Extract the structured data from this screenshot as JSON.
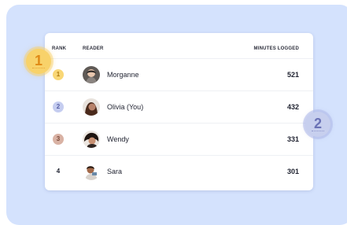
{
  "table": {
    "headers": {
      "rank": "RANK",
      "reader": "READER",
      "minutes": "MINUTES LOGGED"
    },
    "rows": [
      {
        "rank": "1",
        "name": "Morganne",
        "minutes": "521",
        "rank_color": "#f9d776",
        "rank_text_color": "#b07b10"
      },
      {
        "rank": "2",
        "name": "Olivia (You)",
        "minutes": "432",
        "rank_color": "#c5cdf0",
        "rank_text_color": "#5a62a6"
      },
      {
        "rank": "3",
        "name": "Wendy",
        "minutes": "331",
        "rank_color": "#d9b2a4",
        "rank_text_color": "#7a4a3a"
      },
      {
        "rank": "4",
        "name": "Sara",
        "minutes": "301",
        "rank_color": "",
        "rank_text_color": "#1f2230"
      }
    ]
  },
  "callouts": {
    "step1": "1",
    "step2": "2"
  },
  "colors": {
    "backdrop": "#d4e2fd",
    "gold": "#f8d26a",
    "lavender": "#c7cfee"
  }
}
